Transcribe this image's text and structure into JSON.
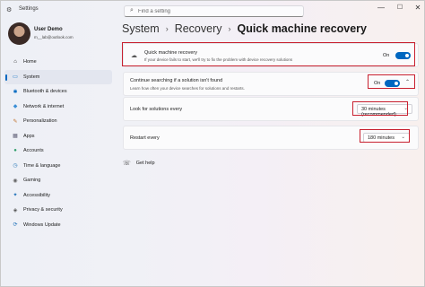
{
  "window": {
    "title": "Settings",
    "controls": {
      "minimize": "—",
      "maximize": "☐",
      "close": "✕"
    }
  },
  "search": {
    "placeholder": "Find a setting",
    "icon": "search-icon"
  },
  "profile": {
    "name": "User Demo",
    "email": "m__lab@outlook.com"
  },
  "nav": {
    "items": [
      {
        "label": "Home",
        "icon": "home-icon",
        "glyph": "⌂"
      },
      {
        "label": "System",
        "icon": "system-icon",
        "glyph": "▭",
        "active": true
      },
      {
        "label": "Bluetooth & devices",
        "icon": "bluetooth-icon",
        "glyph": "✱"
      },
      {
        "label": "Network & internet",
        "icon": "network-icon",
        "glyph": "◆"
      },
      {
        "label": "Personalization",
        "icon": "personalization-icon",
        "glyph": "✎"
      },
      {
        "label": "Apps",
        "icon": "apps-icon",
        "glyph": "▦"
      },
      {
        "label": "Accounts",
        "icon": "accounts-icon",
        "glyph": "●"
      },
      {
        "label": "Time & language",
        "icon": "time-icon",
        "glyph": "◷"
      },
      {
        "label": "Gaming",
        "icon": "gaming-icon",
        "glyph": "◉"
      },
      {
        "label": "Accessibility",
        "icon": "accessibility-icon",
        "glyph": "✦"
      },
      {
        "label": "Privacy & security",
        "icon": "shield-icon",
        "glyph": "◈"
      },
      {
        "label": "Windows Update",
        "icon": "update-icon",
        "glyph": "⟳"
      }
    ]
  },
  "breadcrumb": {
    "items": [
      "System",
      "Recovery"
    ],
    "separator": "›",
    "current": "Quick machine recovery"
  },
  "qmr": {
    "title": "Quick machine recovery",
    "description": "If your device fails to start, we'll try to fix the problem with device recovery solutions",
    "toggle_label": "On",
    "toggle_on": true,
    "icon": "cloud-icon"
  },
  "continue_search": {
    "title": "Continue searching if a solution isn't found",
    "description": "Learn how often your device searches for solutions and restarts.",
    "toggle_label": "On",
    "toggle_on": true
  },
  "look_for": {
    "title": "Look for solutions every",
    "value": "30 minutes (recommended)"
  },
  "restart": {
    "title": "Restart every",
    "value": "180 minutes"
  },
  "help": {
    "label": "Get help",
    "icon": "help-icon"
  },
  "colors": {
    "accent": "#0067c0",
    "highlight": "#c8202f"
  }
}
